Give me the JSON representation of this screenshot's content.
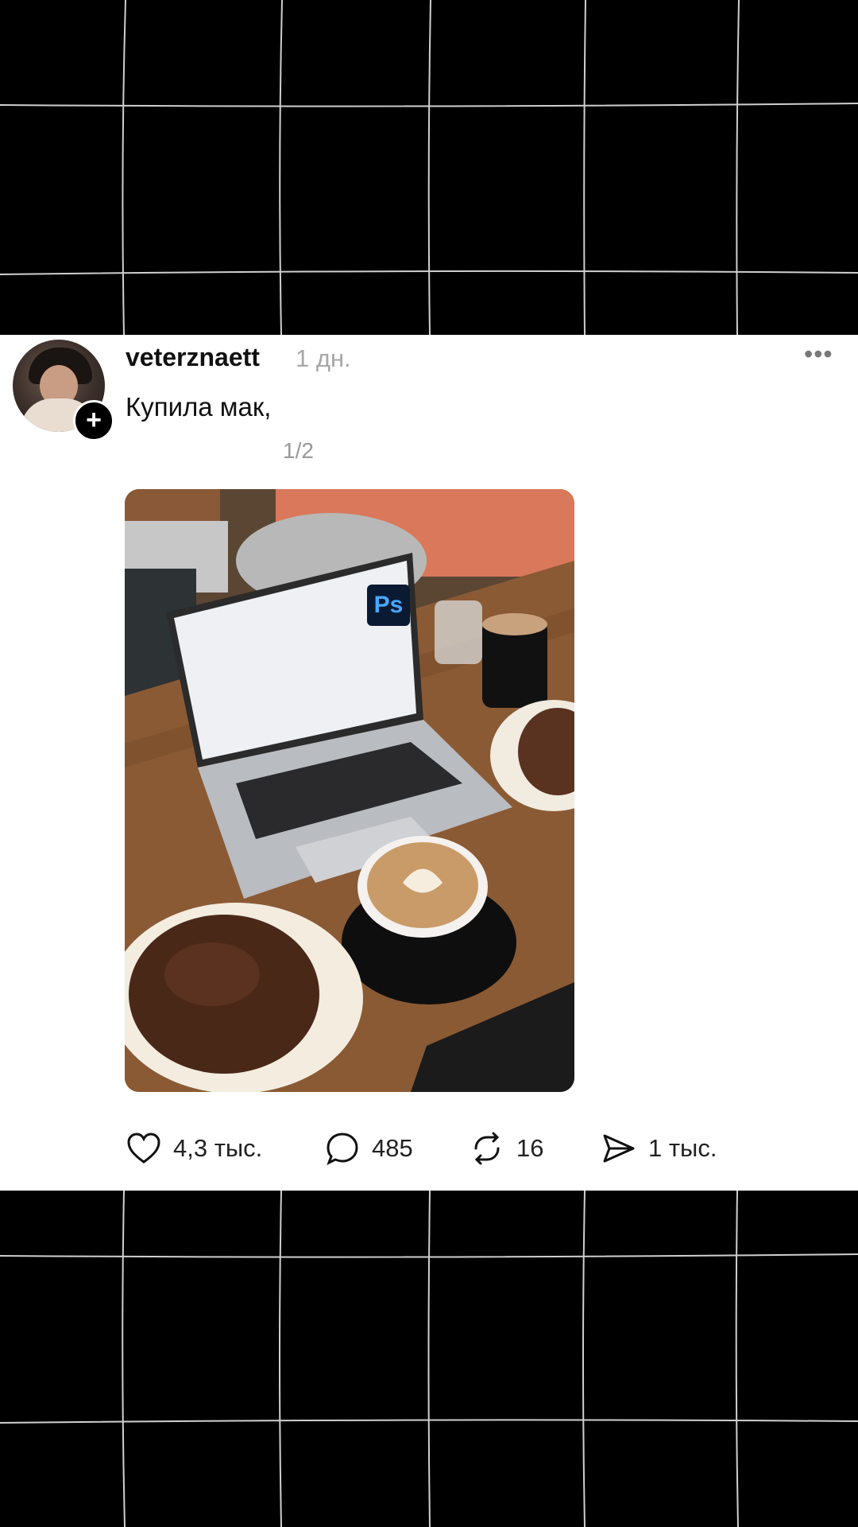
{
  "post": {
    "username": "veterznaett",
    "time_ago": "1 дн.",
    "more_label": "•••",
    "caption": "Купила мак,",
    "media_counter": "1/2",
    "photo_badge": "Ps",
    "follow_label": "+"
  },
  "actions": {
    "likes": "4,3 тыс.",
    "comments": "485",
    "reposts": "16",
    "shares": "1 тыс."
  },
  "icons": [
    "heart-icon",
    "comment-bubble-icon",
    "repost-icon",
    "send-icon",
    "plus-icon",
    "more-dots-icon"
  ]
}
